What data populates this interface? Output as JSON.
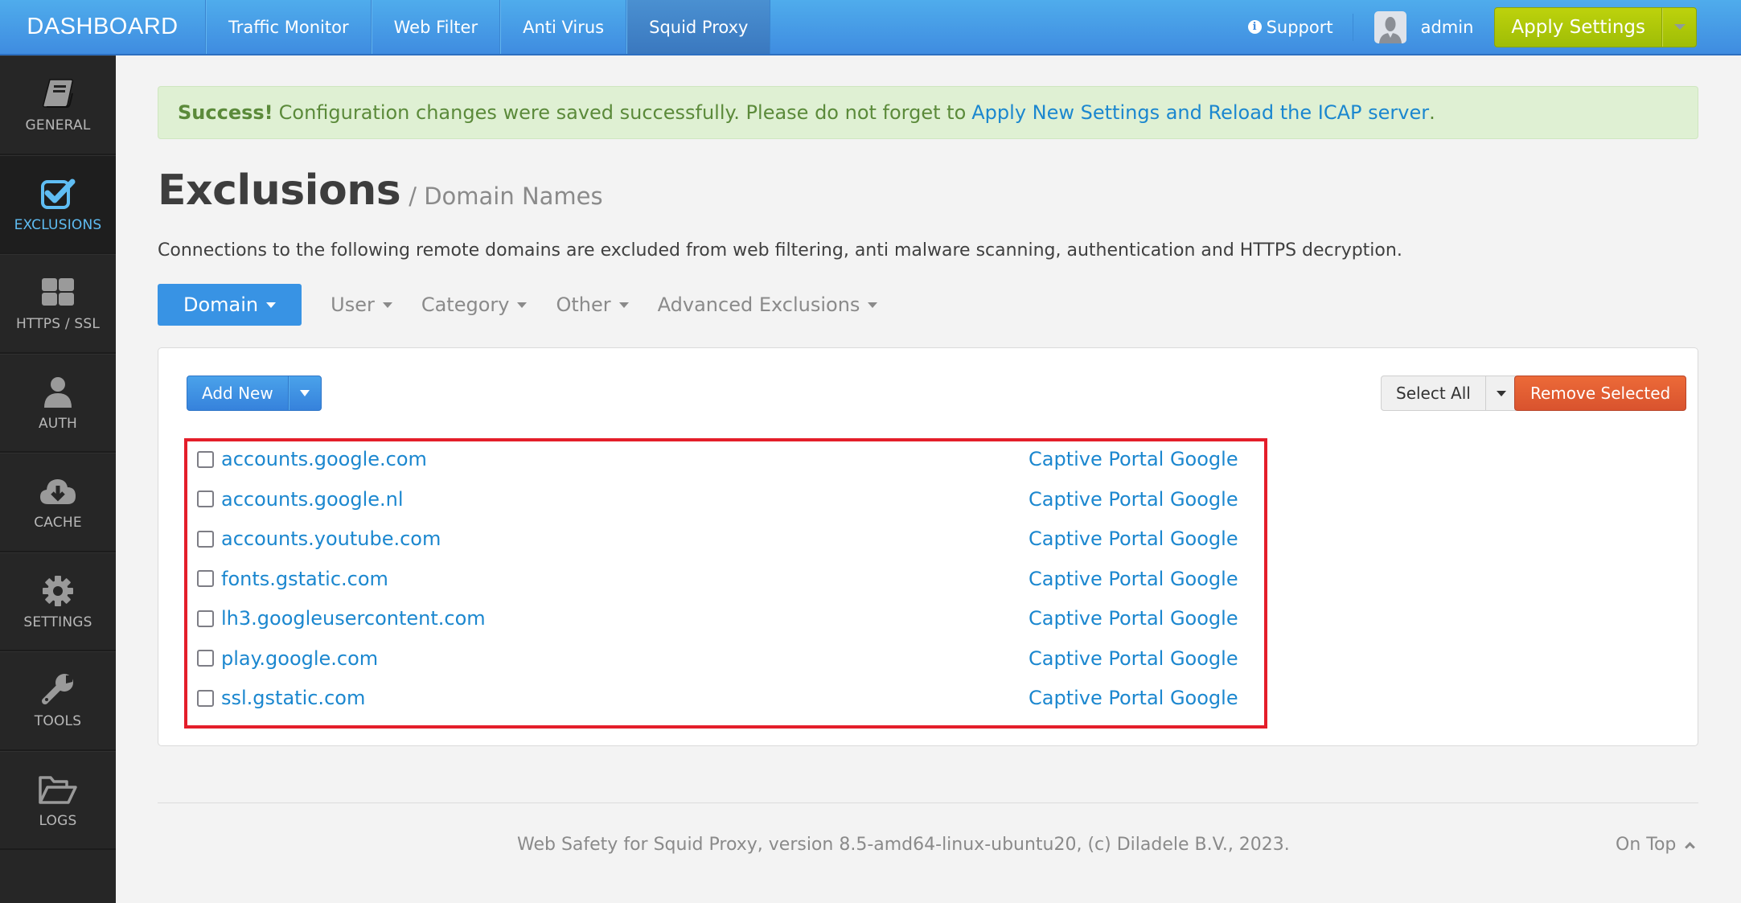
{
  "navbar": {
    "brand": "DASHBOARD",
    "tabs": [
      {
        "label": "Traffic Monitor",
        "active": false
      },
      {
        "label": "Web Filter",
        "active": false
      },
      {
        "label": "Anti Virus",
        "active": false
      },
      {
        "label": "Squid Proxy",
        "active": true
      }
    ],
    "support_label": "Support",
    "support_icon": "info-icon",
    "username": "admin",
    "apply_label": "Apply Settings"
  },
  "sidebar": {
    "items": [
      {
        "label": "GENERAL",
        "icon": "book-icon",
        "active": false
      },
      {
        "label": "EXCLUSIONS",
        "icon": "checkbox-icon",
        "active": true
      },
      {
        "label": "HTTPS / SSL",
        "icon": "grid-icon",
        "active": false
      },
      {
        "label": "AUTH",
        "icon": "user-icon",
        "active": false
      },
      {
        "label": "CACHE",
        "icon": "cloud-download-icon",
        "active": false
      },
      {
        "label": "SETTINGS",
        "icon": "gear-icon",
        "active": false
      },
      {
        "label": "TOOLS",
        "icon": "wrench-icon",
        "active": false
      },
      {
        "label": "LOGS",
        "icon": "folder-open-icon",
        "active": false
      }
    ]
  },
  "alert": {
    "strong": "Success!",
    "message": "Configuration changes were saved successfully. Please do not forget to",
    "link": "Apply New Settings and Reload the ICAP server",
    "end": ".",
    "colors": {
      "background": "#dff0d3",
      "text": "#5b8a3a",
      "link": "#1b87cf"
    }
  },
  "page": {
    "title": "Exclusions",
    "subtitle": "/ Domain Names",
    "description": "Connections to the following remote domains are excluded from web filtering, anti malware scanning, authentication and HTTPS decryption."
  },
  "tabs": {
    "active": "Domain",
    "others": [
      "User",
      "Category",
      "Other",
      "Advanced Exclusions"
    ]
  },
  "toolbar": {
    "add_new": "Add New",
    "select_all": "Select All",
    "remove_selected": "Remove Selected"
  },
  "domains": [
    {
      "domain": "accounts.google.com",
      "category": "Captive Portal Google",
      "checked": false
    },
    {
      "domain": "accounts.google.nl",
      "category": "Captive Portal Google",
      "checked": false
    },
    {
      "domain": "accounts.youtube.com",
      "category": "Captive Portal Google",
      "checked": false
    },
    {
      "domain": "fonts.gstatic.com",
      "category": "Captive Portal Google",
      "checked": false
    },
    {
      "domain": "lh3.googleusercontent.com",
      "category": "Captive Portal Google",
      "checked": false
    },
    {
      "domain": "play.google.com",
      "category": "Captive Portal Google",
      "checked": false
    },
    {
      "domain": "ssl.gstatic.com",
      "category": "Captive Portal Google",
      "checked": false
    }
  ],
  "footer": {
    "text": "Web Safety for Squid Proxy, version 8.5-amd64-linux-ubuntu20, (c) Diladele B.V., 2023.",
    "on_top": "On Top"
  },
  "colors": {
    "navbar": "#4a9de6",
    "sidebar": "#262626",
    "sidebar_active": "#5fbdf3",
    "primary": "#3893e4",
    "apply": "#aec80a",
    "danger": "#e0592f",
    "highlight_box": "#e41e2a",
    "link": "#1b87cf"
  }
}
